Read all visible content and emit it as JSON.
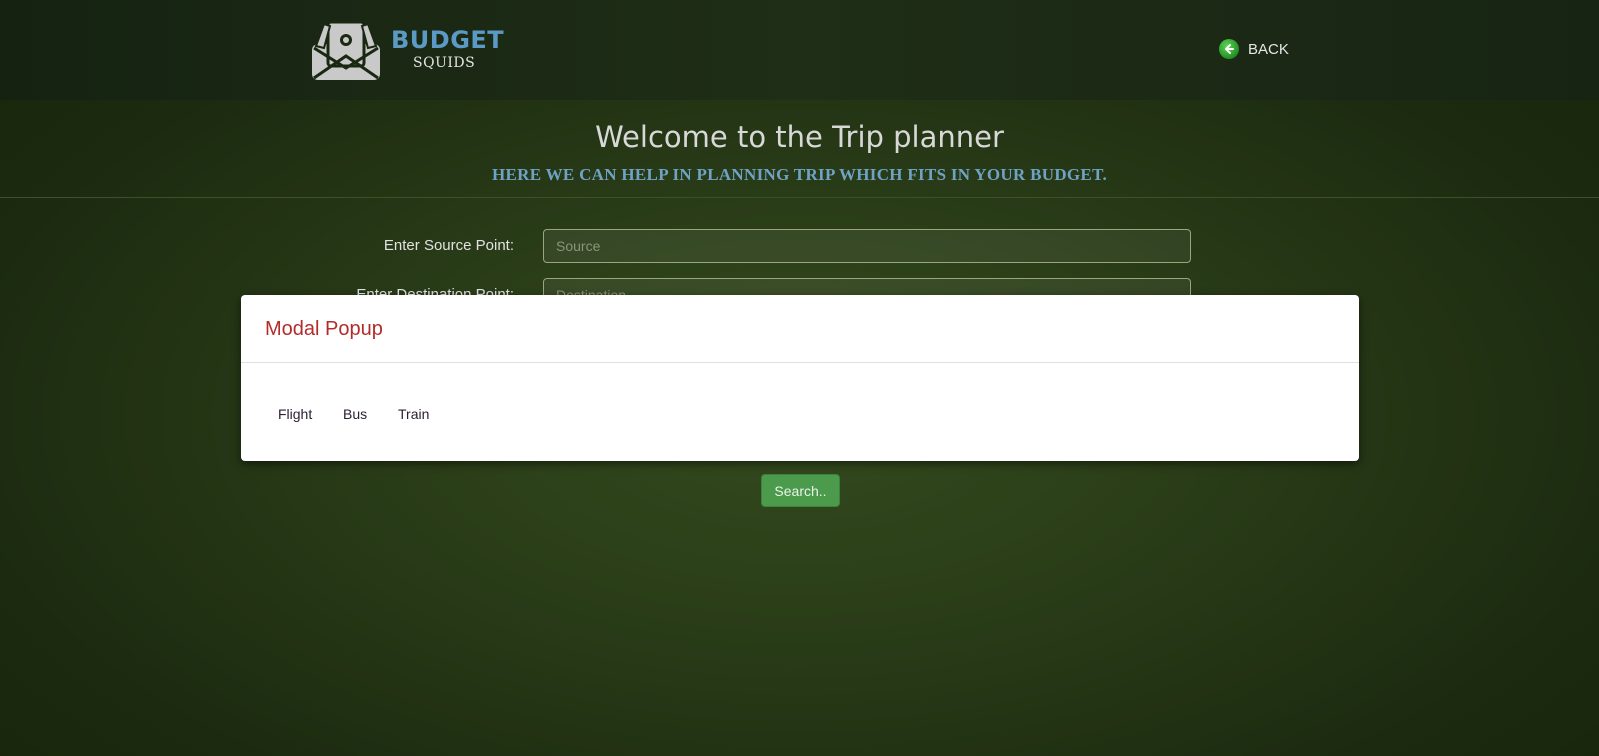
{
  "header": {
    "logo": {
      "word1": "BUDGET",
      "word2": "SQUIDS"
    },
    "back_label": "BACK"
  },
  "hero": {
    "title": "Welcome to the Trip planner",
    "subtitle": "HERE WE CAN HELP IN PLANNING TRIP WHICH FITS IN YOUR BUDGET."
  },
  "form": {
    "source_label": "Enter Source Point:",
    "source_placeholder": "Source",
    "destination_label": "Enter Destination Point:",
    "destination_placeholder": "Destination",
    "search_label": "Search.."
  },
  "modal": {
    "title": "Modal Popup",
    "options": [
      "Flight",
      "Bus",
      "Train"
    ]
  },
  "colors": {
    "logo_accent": "#5b9ac4",
    "subtitle": "#6fa3c6",
    "modal_title": "#b32b2b",
    "search_button": "#4c9a4c",
    "back_icon": "#2a9a2a"
  },
  "icons": [
    "logo-envelope-money-icon",
    "back-arrow-icon"
  ]
}
